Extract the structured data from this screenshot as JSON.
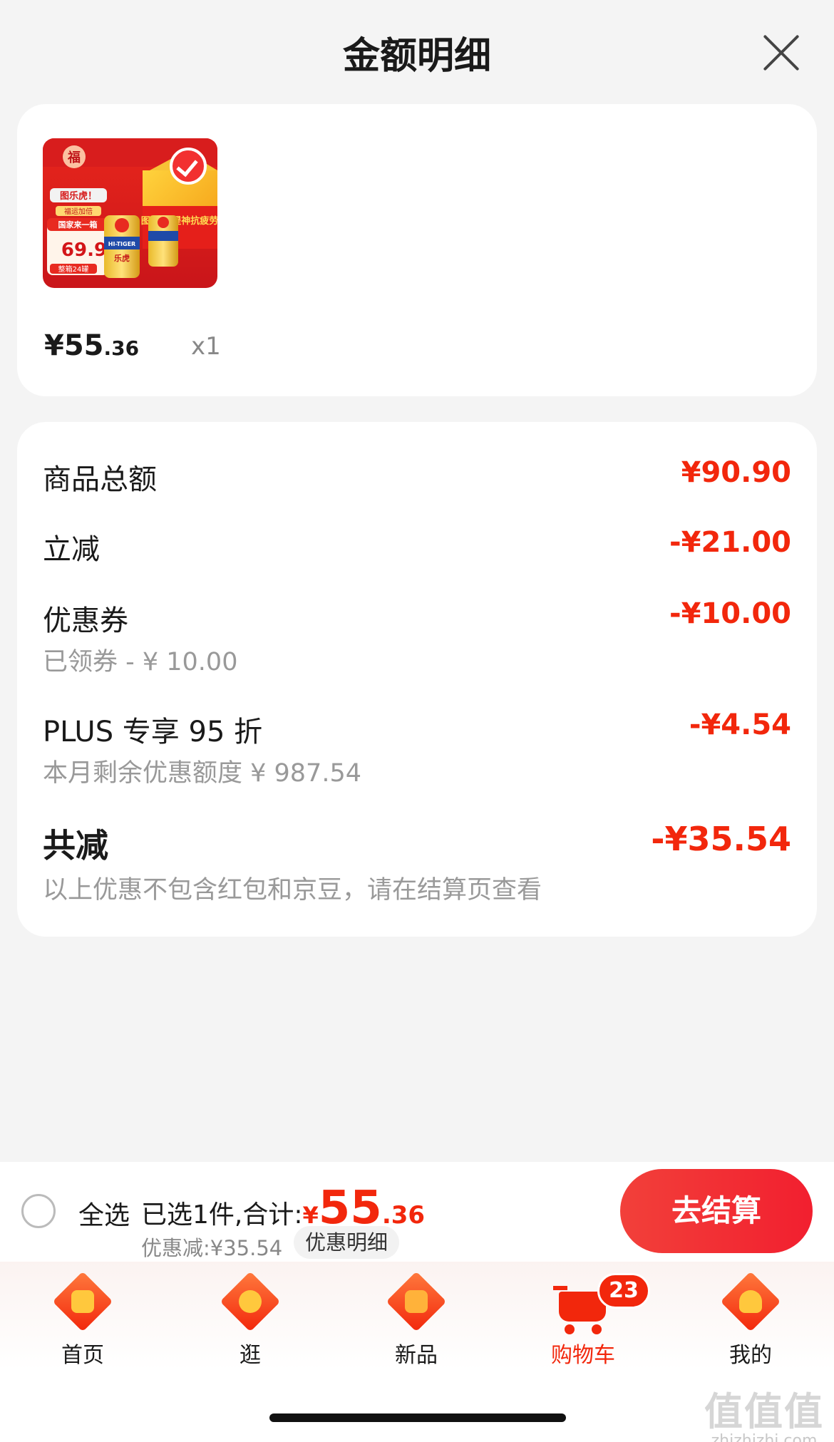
{
  "sheet": {
    "title": "金额明细",
    "close_icon": "close-icon"
  },
  "product": {
    "price_symbol": "¥",
    "price_main": "55",
    "price_cents": ".36",
    "quantity": "x1",
    "checked": true,
    "image_texts": {
      "badge": "福",
      "banner": "图乐虎！",
      "sub_banner": "福运加倍",
      "promo": "国家来一箱",
      "price": "69.9",
      "pack": "整箱24罐",
      "can_brand": "HI-TIGER",
      "can_cn": "乐虎",
      "box_slogan": "图乐虎 提神抗疲劳"
    }
  },
  "details": {
    "rows": [
      {
        "label": "商品总额",
        "value": "¥90.90"
      },
      {
        "label": "立减",
        "value": "-¥21.00"
      },
      {
        "label": "优惠券",
        "value": "-¥10.00",
        "sub": "已领券 - ¥ 10.00"
      },
      {
        "label": "PLUS 专享 95 折",
        "value": "-¥4.54",
        "sub": "本月剩余优惠额度  ¥ 987.54"
      }
    ],
    "total": {
      "label": "共减",
      "value": "-¥35.54",
      "note": "以上优惠不包含红包和京豆，请在结算页查看"
    }
  },
  "checkout": {
    "select_all": "全选",
    "summary_prefix": "已选1件,合计:",
    "total_symbol": "¥",
    "total_main": "55",
    "total_cents": ".36",
    "discount": "优惠减:¥35.54",
    "detail_link": "优惠明细",
    "button": "去结算"
  },
  "tabs": [
    {
      "label": "首页",
      "icon": "home-icon",
      "active": false
    },
    {
      "label": "逛",
      "icon": "browse-icon",
      "active": false
    },
    {
      "label": "新品",
      "icon": "new-products-icon",
      "active": false
    },
    {
      "label": "购物车",
      "icon": "cart-icon",
      "active": true,
      "badge": "23"
    },
    {
      "label": "我的",
      "icon": "profile-icon",
      "active": false
    }
  ],
  "watermark": {
    "main": "值值值",
    "sub": "zhizhizhi.com"
  },
  "colors": {
    "accent": "#f2270c",
    "background": "#f4f4f4",
    "card": "#ffffff"
  }
}
